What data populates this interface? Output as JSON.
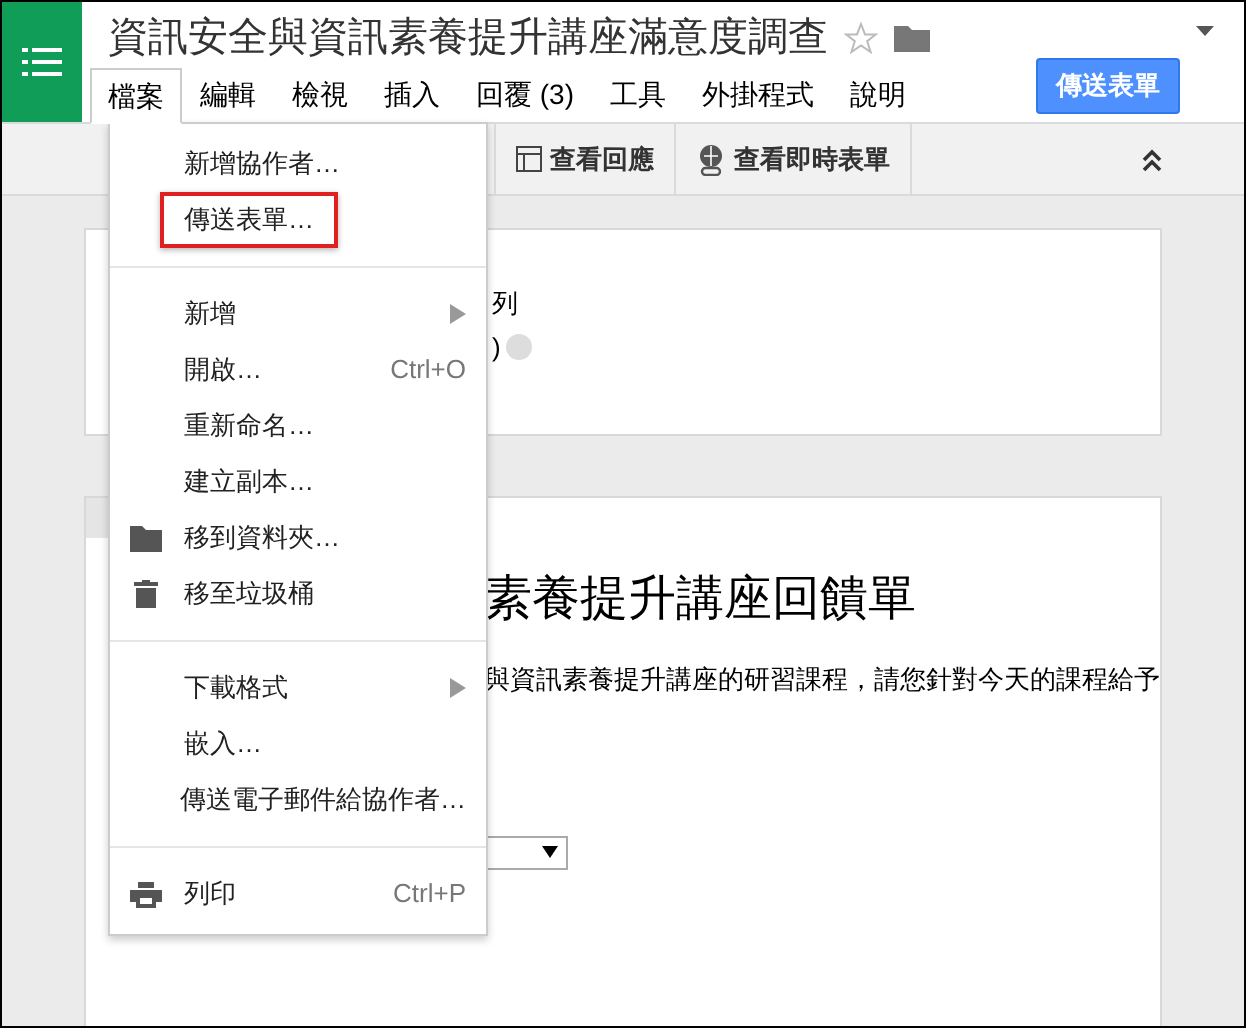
{
  "header": {
    "title": "資訊安全與資訊素養提升講座滿意度調查",
    "starred": false,
    "send_button": "傳送表單"
  },
  "menubar": [
    {
      "label": "檔案",
      "selected": true
    },
    {
      "label": "編輯",
      "selected": false
    },
    {
      "label": "檢視",
      "selected": false
    },
    {
      "label": "插入",
      "selected": false
    },
    {
      "label": "回覆 (3)",
      "selected": false
    },
    {
      "label": "工具",
      "selected": false
    },
    {
      "label": "外掛程式",
      "selected": false
    },
    {
      "label": "說明",
      "selected": false
    }
  ],
  "toolbar": [
    {
      "kind": "responses",
      "label": "查看回應"
    },
    {
      "kind": "live",
      "label": "查看即時表單"
    }
  ],
  "menu": [
    {
      "kind": "item",
      "label": "新增協作者…",
      "highlighted": false
    },
    {
      "kind": "item",
      "label": "傳送表單…",
      "highlighted": true
    },
    {
      "kind": "separator"
    },
    {
      "kind": "item",
      "label": "新增",
      "submenu": true,
      "highlighted": false
    },
    {
      "kind": "item",
      "label": "開啟…",
      "shortcut": "Ctrl+O",
      "highlighted": false
    },
    {
      "kind": "item",
      "label": "重新命名…",
      "highlighted": false
    },
    {
      "kind": "item",
      "label": "建立副本…",
      "highlighted": false
    },
    {
      "kind": "folder",
      "label": "移到資料夾…",
      "highlighted": false
    },
    {
      "kind": "trash",
      "label": "移至垃圾桶",
      "highlighted": false
    },
    {
      "kind": "separator"
    },
    {
      "kind": "item",
      "label": "下載格式",
      "submenu": true,
      "highlighted": false
    },
    {
      "kind": "item",
      "label": "嵌入…",
      "highlighted": false
    },
    {
      "kind": "item",
      "label": "傳送電子郵件給協作者…",
      "highlighted": false
    },
    {
      "kind": "separator"
    },
    {
      "kind": "print",
      "label": "列印",
      "shortcut": "Ctrl+P",
      "highlighted": false
    }
  ],
  "settings_card": {
    "line_1": "列",
    "line_2": ")"
  },
  "form_card": {
    "title": "素養提升講座回饋單",
    "description": "與資訊素養提升講座的研習課程，請您針對今天的課程給予"
  }
}
